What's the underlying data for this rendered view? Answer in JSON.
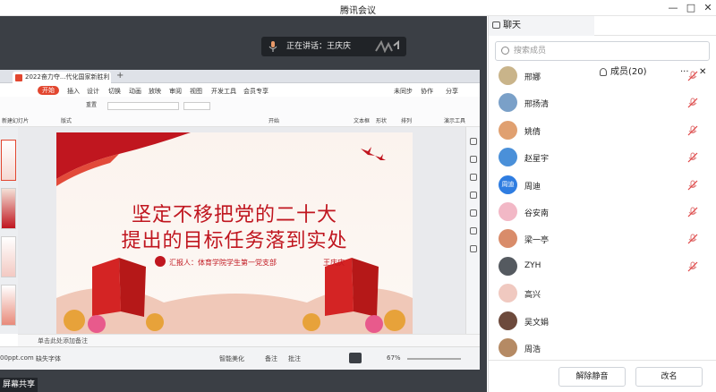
{
  "window": {
    "title": "腾讯会议",
    "minimize": "—",
    "maximize": "□",
    "close": "✕"
  },
  "stage": {
    "speaking_label": "正在讲话：王庆庆"
  },
  "ppt": {
    "file_tab": "2022奋力夺...代化国家新胜利",
    "menu": [
      "开始",
      "插入",
      "设计",
      "切换",
      "动画",
      "放映",
      "审阅",
      "视图",
      "开发工具",
      "会员专享"
    ],
    "menu_right": [
      "未同步",
      "协作",
      "分享"
    ],
    "ribbon": [
      "新建幻灯片",
      "版式",
      "重置",
      "开始",
      "文本框",
      "形状",
      "排列",
      "演示工具"
    ],
    "slide": {
      "line1": "坚定不移把党的二十大",
      "line2": "提出的目标任务落到实处",
      "reporter": "汇报人：体育学院学生第一党支部",
      "name": "王庆庆"
    },
    "notes": "单击此处添加备注",
    "status": {
      "source": "00ppt.com",
      "font": "缺失字体",
      "smart": "智能美化",
      "notes_btn": "备注",
      "comment": "批注",
      "zoom": "67%"
    }
  },
  "share_label": "屏幕共享",
  "panel": {
    "tab_chat": "聊天",
    "tab_members": "成员(20)",
    "search_placeholder": "搜索成员",
    "members": [
      {
        "name": "邢娜",
        "avatar": "",
        "muted": true,
        "color": "#c9b48a"
      },
      {
        "name": "邢扬清",
        "avatar": "",
        "muted": true,
        "color": "#7aa0c8"
      },
      {
        "name": "姚倩",
        "avatar": "",
        "muted": true,
        "color": "#e0a070"
      },
      {
        "name": "赵星宇",
        "avatar": "",
        "muted": true,
        "color": "#4a90d9"
      },
      {
        "name": "周迪",
        "avatar": "周迪",
        "muted": true,
        "color": "#2f7de1"
      },
      {
        "name": "谷安南",
        "avatar": "",
        "muted": true,
        "color": "#f2b8c6"
      },
      {
        "name": "梁一亭",
        "avatar": "",
        "muted": true,
        "color": "#d98c6a"
      },
      {
        "name": "ZYH",
        "avatar": "",
        "muted": true,
        "color": "#555a60"
      },
      {
        "name": "高兴",
        "avatar": "",
        "muted": false,
        "color": "#f0c9c0"
      },
      {
        "name": "吴文娟",
        "avatar": "",
        "muted": false,
        "color": "#6d4a3c"
      },
      {
        "name": "周浩",
        "avatar": "",
        "muted": false,
        "color": "#b58a64"
      }
    ],
    "btn_unmute": "解除静音",
    "btn_rename": "改名"
  }
}
